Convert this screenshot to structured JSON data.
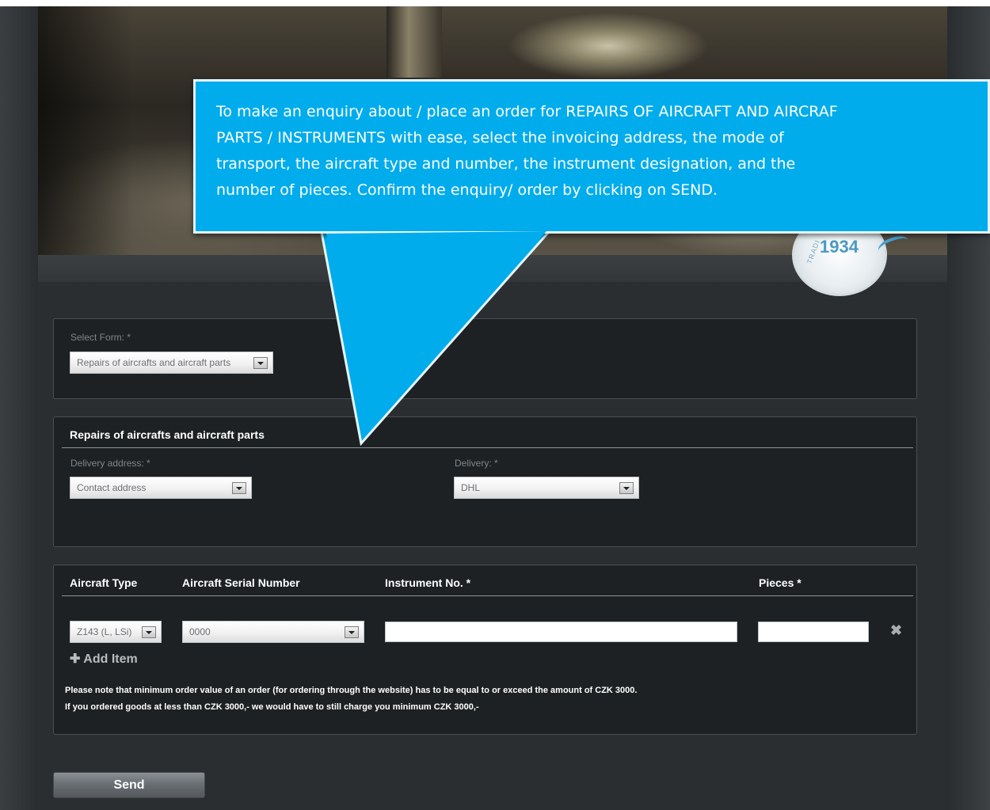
{
  "hero": {
    "badge_year": "1934",
    "badge_text": "TRADI"
  },
  "callout": {
    "text": "To make an enquiry about / place an order for REPAIRS OF AIRCRAFT AND AIRCRAF\nPARTS / INSTRUMENTS with ease, select the invoicing address, the mode of\ntransport, the aircraft type and number, the instrument designation, and the\nnumber of pieces. Confirm the enquiry/ order by clicking on SEND.",
    "color": "#00acec"
  },
  "select_form": {
    "label": "Select Form: *",
    "value": "Repairs of aircrafts and aircraft parts"
  },
  "repairs_section": {
    "title": "Repairs of aircrafts and aircraft parts",
    "delivery_address_label": "Delivery address: *",
    "delivery_address_value": "Contact address",
    "delivery_label": "Delivery: *",
    "delivery_value": "DHL"
  },
  "items_table": {
    "headers": {
      "aircraft_type": "Aircraft Type",
      "serial_number": "Aircraft Serial Number",
      "instrument_no": "Instrument No. *",
      "pieces": "Pieces *"
    },
    "row": {
      "aircraft_type_value": "Z143 (L, LSi)",
      "serial_number_value": "0000",
      "instrument_no_value": "",
      "pieces_value": ""
    },
    "remove_icon": "✖",
    "add_item_label": "Add Item",
    "note_line1": "Please note that minimum order value of an order (for ordering through the website) has to be equal to or exceed the amount of CZK 3000.",
    "note_line2": "If you ordered goods at less than CZK 3000,- we would have to still charge you minimum CZK 3000,-"
  },
  "send_label": "Send"
}
